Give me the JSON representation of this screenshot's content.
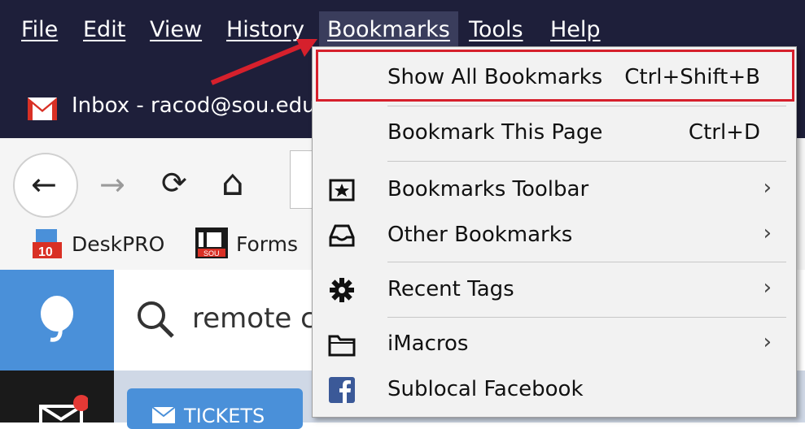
{
  "menubar": {
    "items": [
      {
        "label": "File"
      },
      {
        "label": "Edit"
      },
      {
        "label": "View"
      },
      {
        "label": "History"
      },
      {
        "label": "Bookmarks"
      },
      {
        "label": "Tools"
      },
      {
        "label": "Help"
      }
    ]
  },
  "tab": {
    "title": "Inbox - racod@sou.edu",
    "icon": "gmail-icon"
  },
  "toolbar": {
    "back_icon": "←",
    "forward_icon": "→",
    "reload_icon": "⟳",
    "home_icon": "⌂"
  },
  "bookmarks_bar": {
    "items": [
      {
        "label": "DeskPRO",
        "badge": "10"
      },
      {
        "label": "Forms",
        "badge": "SOU"
      }
    ]
  },
  "page": {
    "search_text": "remote c",
    "tickets_label": "TICKETS"
  },
  "bookmarks_menu": {
    "items": [
      {
        "label": "Show All Bookmarks",
        "shortcut": "Ctrl+Shift+B",
        "icon": ""
      },
      {
        "label": "Bookmark This Page",
        "shortcut": "Ctrl+D",
        "icon": ""
      },
      {
        "label": "Bookmarks Toolbar",
        "icon": "star-toolbar-icon",
        "submenu": true
      },
      {
        "label": "Other Bookmarks",
        "icon": "tray-icon",
        "submenu": true
      },
      {
        "label": "Recent Tags",
        "icon": "gear-icon",
        "submenu": true
      },
      {
        "label": "iMacros",
        "icon": "folder-icon",
        "submenu": true
      },
      {
        "label": "Sublocal Facebook",
        "icon": "facebook-icon"
      }
    ],
    "chevron": "›"
  },
  "colors": {
    "menubar_bg": "#1e1f3a",
    "highlight": "#d6202c",
    "accent": "#4a90d9"
  }
}
